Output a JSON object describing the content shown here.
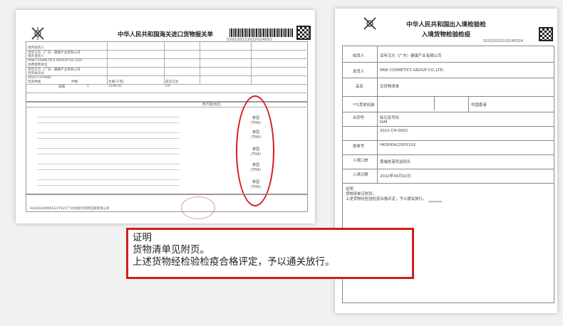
{
  "left_doc": {
    "title": "中华人民共和国海关进口货物报关单",
    "doc_no": "520220221022024052",
    "header_fields": [
      {
        "label": "境内收货人",
        "value": "百年汉方（广东）健康产业有限公司"
      },
      {
        "label": "境外发货人",
        "value": "PAW COSMETICS GROUP CO.,LTD."
      },
      {
        "label": "消费使用单位",
        "value": "百年汉方（广东）健康产业有限公司"
      },
      {
        "label": "合同协议号",
        "value": "2022-CH-0002"
      },
      {
        "label": "包装种类",
        "value": "纸箱"
      },
      {
        "label": "件数",
        "value": "1"
      },
      {
        "label": "毛重(千克)",
        "value": "1196.92"
      },
      {
        "label": "成交方式",
        "value": "CIF"
      }
    ],
    "origin_stamps": [
      "泰国",
      "(THA)",
      "泰国",
      "(THA)",
      "泰国",
      "(THA)",
      "泰国",
      "(THA)",
      "泰国",
      "(THA)"
    ],
    "col_origin": "原产国(地区)",
    "footer_company": "91440300MA5G1Y9U7广州优质外贸供应链有限公司"
  },
  "right_doc": {
    "title1": "中华人民共和国出入境检验检",
    "title2": "入境货物检验检疫",
    "serial": "52022022102240524",
    "rows": [
      {
        "label": "收货人",
        "value": "百年汉方（广东）健康产业有限公司"
      },
      {
        "label": "发货人",
        "value": "PAW COSMETICS GROUP CO.,LTD."
      },
      {
        "label": "品名",
        "value": "见货物清单"
      },
      {
        "label": "标记及号码",
        "value": "N/M"
      },
      {
        "label": "合同号",
        "value": "2022-CH-0002"
      },
      {
        "label": "提单号",
        "value": "HKGHEA22001102"
      },
      {
        "label": "入境口岸",
        "value": "黄埔老港货运码头"
      },
      {
        "label": "入境日期",
        "value": "2022年04月02日"
      }
    ],
    "qty": "**2其他包装",
    "origin": "中国香港",
    "cert_label": "证明",
    "cert_line1": "货物清单见附页。",
    "cert_line2": "上述货物经检验检疫合格评定，予以通关放行。",
    "stars": "*******"
  },
  "notice": {
    "line1": "证明",
    "line2": "货物清单见附页。",
    "line3": "上述货物经检验检疫合格评定，予以通关放行。"
  }
}
